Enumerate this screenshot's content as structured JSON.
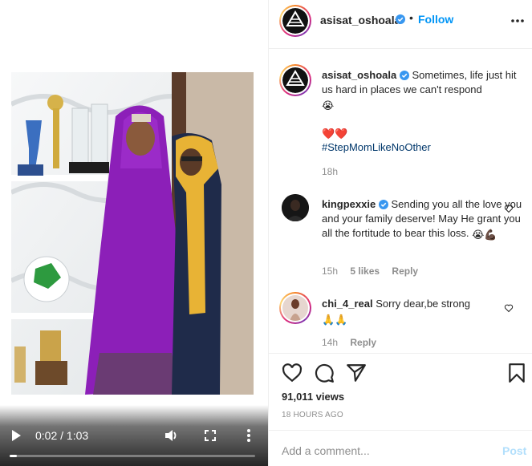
{
  "colors": {
    "accent": "#0095f6",
    "text": "#262626",
    "muted": "#8e8e8e",
    "heart": "#ed4956"
  },
  "video": {
    "time_current": "0:02",
    "time_total": "1:03",
    "time_separator": "/",
    "progress_fraction": 0.03,
    "icons": [
      "play-icon",
      "volume-icon",
      "fullscreen-icon",
      "more-vertical-icon"
    ]
  },
  "header": {
    "username": "asisat_oshoala",
    "dot": "•",
    "follow_label": "Follow",
    "icons": [
      "verified-badge-icon",
      "more-horizontal-icon"
    ]
  },
  "caption": {
    "username": "asisat_oshoala",
    "text": "Sometimes, life just hit us hard in places we can't respond",
    "emoji_line1": "😭",
    "emoji_line2": "❤️❤️",
    "hashtag": "#StepMomLikeNoOther",
    "time": "18h"
  },
  "comments": [
    {
      "username": "kingpexxie",
      "verified": true,
      "text": "Sending you all the love you and your family deserve! May He grant you all the fortitude to bear this loss.",
      "emoji": "😭💪🏿",
      "time": "15h",
      "likes": "5 likes",
      "reply_label": "Reply"
    },
    {
      "username": "chi_4_real",
      "verified": false,
      "text": "Sorry dear,be strong",
      "emoji": "🙏🙏",
      "time": "14h",
      "reply_label": "Reply"
    }
  ],
  "actions": {
    "icons": [
      "heart-icon",
      "comment-icon",
      "share-icon",
      "bookmark-icon"
    ],
    "views": "91,011 views",
    "posted": "18 HOURS AGO"
  },
  "composer": {
    "placeholder": "Add a comment...",
    "post_label": "Post"
  }
}
